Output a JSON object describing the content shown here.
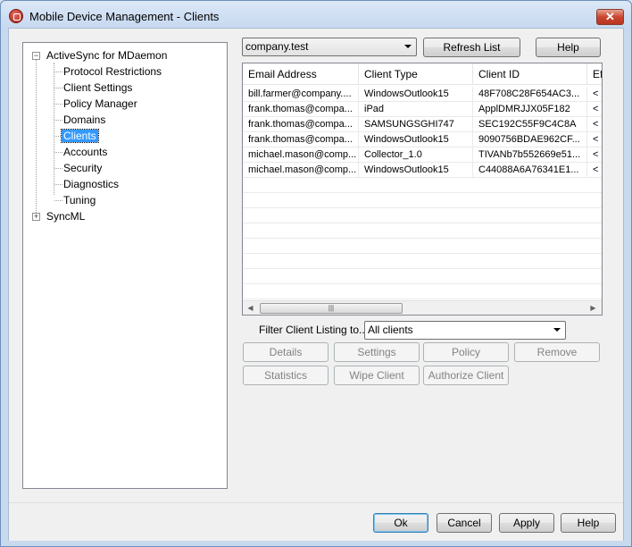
{
  "window": {
    "title": "Mobile Device Management - Clients",
    "close_label": "✕"
  },
  "tree": {
    "root": {
      "label": "ActiveSync for MDaemon",
      "expander": "−"
    },
    "children": [
      "Protocol Restrictions",
      "Client Settings",
      "Policy Manager",
      "Domains",
      "Clients",
      "Accounts",
      "Security",
      "Diagnostics",
      "Tuning"
    ],
    "selected": "Clients",
    "second_root": {
      "label": "SyncML",
      "expander": "+"
    }
  },
  "domain_select": {
    "value": "company.test"
  },
  "toolbar": {
    "refresh_label": "Refresh List",
    "help_label": "Help"
  },
  "list": {
    "columns": [
      "Email Address",
      "Client Type",
      "Client ID",
      "Ef"
    ],
    "rows": [
      [
        "bill.farmer@company....",
        "WindowsOutlook15",
        "48F708C28F654AC3...",
        "<"
      ],
      [
        "frank.thomas@compa...",
        "iPad",
        "ApplDMRJJX05F182",
        "<"
      ],
      [
        "frank.thomas@compa...",
        "SAMSUNGSGHI747",
        "SEC192C55F9C4C8A",
        "<"
      ],
      [
        "frank.thomas@compa...",
        "WindowsOutlook15",
        "9090756BDAE962CF...",
        "<"
      ],
      [
        "michael.mason@comp...",
        "Collector_1.0",
        "TIVANb7b552669e51...",
        "<"
      ],
      [
        "michael.mason@comp...",
        "WindowsOutlook15",
        "C44088A6A76341E1...",
        "<"
      ]
    ],
    "scroll_left": "◀",
    "scroll_right": "▶",
    "thumb_grip": "|||"
  },
  "filter": {
    "label": "Filter Client Listing to...",
    "value": "All clients"
  },
  "actions": {
    "details": "Details",
    "settings": "Settings",
    "policy": "Policy",
    "remove": "Remove",
    "statistics": "Statistics",
    "wipe_client": "Wipe Client",
    "authorize_client": "Authorize Client"
  },
  "footer": {
    "ok": "Ok",
    "cancel": "Cancel",
    "apply": "Apply",
    "help": "Help"
  }
}
